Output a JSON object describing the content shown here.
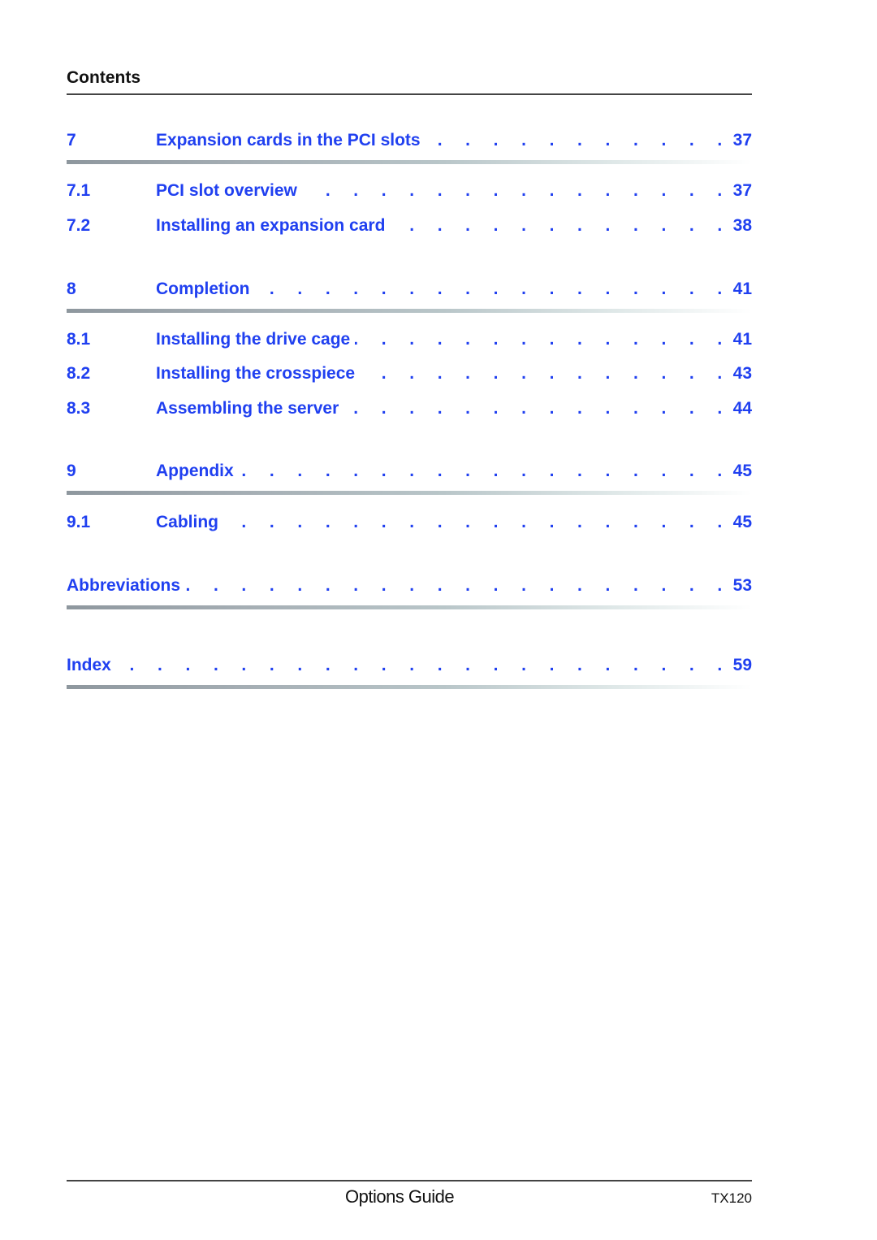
{
  "header": {
    "title": "Contents"
  },
  "toc": [
    {
      "num": "7",
      "title": "Expansion cards in the PCI slots",
      "page": "37",
      "level": 1
    },
    {
      "num": "7.1",
      "title": "PCI slot overview",
      "page": "37",
      "level": 2
    },
    {
      "num": "7.2",
      "title": "Installing an expansion card",
      "page": "38",
      "level": 2
    },
    {
      "num": "8",
      "title": "Completion",
      "page": "41",
      "level": 1
    },
    {
      "num": "8.1",
      "title": "Installing the drive cage",
      "page": "41",
      "level": 2
    },
    {
      "num": "8.2",
      "title": "Installing the crosspiece",
      "page": "43",
      "level": 2
    },
    {
      "num": "8.3",
      "title": "Assembling the server",
      "page": "44",
      "level": 2
    },
    {
      "num": "9",
      "title": "Appendix",
      "page": "45",
      "level": 1
    },
    {
      "num": "9.1",
      "title": "Cabling",
      "page": "45",
      "level": 2
    },
    {
      "num": "",
      "title": "Abbreviations",
      "page": "53",
      "level": 0
    },
    {
      "num": "",
      "title": "Index",
      "page": "59",
      "level": 0
    }
  ],
  "leader_dots": ". . . . . . . . . . . . . . . . . . . . . . . . . . . . . . . . . . . . . . . . . . . . . . . . . . .",
  "footer": {
    "title": "Options Guide",
    "model": "TX120"
  },
  "colors": {
    "link": "#2040f0",
    "text": "#111111"
  }
}
